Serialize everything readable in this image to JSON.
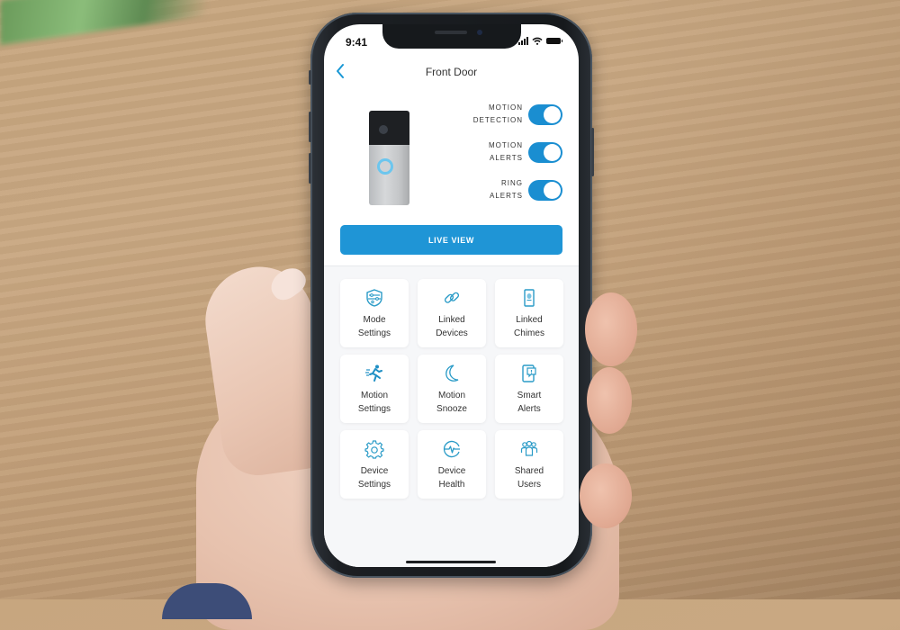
{
  "status_bar": {
    "time": "9:41"
  },
  "header": {
    "title": "Front Door",
    "back_icon": "chevron-left-icon"
  },
  "device": {
    "image": "doorbell-image"
  },
  "toggles": [
    {
      "line1": "MOTION",
      "line2": "DETECTION",
      "on": true
    },
    {
      "line1": "MOTION",
      "line2": "ALERTS",
      "on": true
    },
    {
      "line1": "RING",
      "line2": "ALERTS",
      "on": true
    }
  ],
  "live_view": {
    "label": "LIVE VIEW"
  },
  "tiles": [
    {
      "line1": "Mode",
      "line2": "Settings",
      "icon": "mode-shield-icon"
    },
    {
      "line1": "Linked",
      "line2": "Devices",
      "icon": "link-icon"
    },
    {
      "line1": "Linked",
      "line2": "Chimes",
      "icon": "chime-icon"
    },
    {
      "line1": "Motion",
      "line2": "Settings",
      "icon": "running-person-icon"
    },
    {
      "line1": "Motion",
      "line2": "Snooze",
      "icon": "moon-icon"
    },
    {
      "line1": "Smart",
      "line2": "Alerts",
      "icon": "smart-alert-icon"
    },
    {
      "line1": "Device",
      "line2": "Settings",
      "icon": "gear-icon"
    },
    {
      "line1": "Device",
      "line2": "Health",
      "icon": "heartbeat-icon"
    },
    {
      "line1": "Shared",
      "line2": "Users",
      "icon": "users-icon"
    }
  ],
  "colors": {
    "accent": "#1f95d6",
    "icon": "#2a9bc7",
    "toggle_on": "#1a8ed1"
  }
}
